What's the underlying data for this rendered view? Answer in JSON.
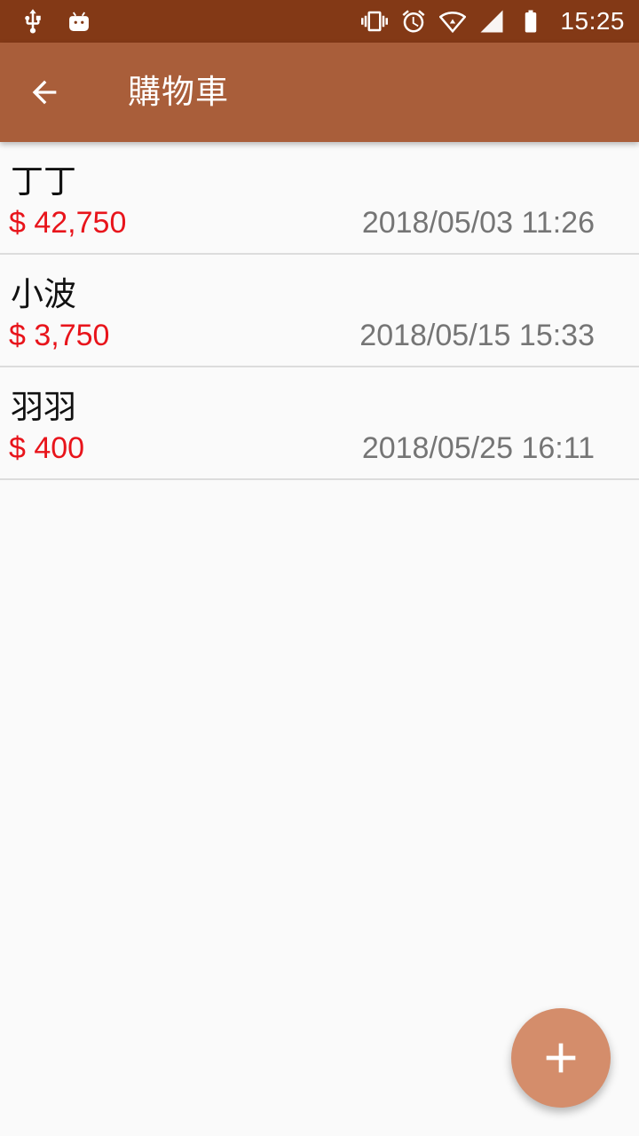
{
  "status_bar": {
    "time": "15:25",
    "left_icons": [
      "usb-icon",
      "android-debug-icon"
    ],
    "right_icons": [
      "vibrate-icon",
      "alarm-icon",
      "wifi-icon",
      "signal-icon",
      "battery-icon"
    ]
  },
  "app_bar": {
    "title": "購物車",
    "back_icon": "arrow-back-icon"
  },
  "colors": {
    "status_bar": "#833916",
    "app_bar": "#a95e3a",
    "price": "#e8141b",
    "date": "#757575",
    "fab": "#d48d6b"
  },
  "carts": [
    {
      "name": "丁丁",
      "price": "$ 42,750",
      "date": "2018/05/03 11:26"
    },
    {
      "name": "小波",
      "price": "$ 3,750",
      "date": "2018/05/15 15:33"
    },
    {
      "name": "羽羽",
      "price": "$ 400",
      "date": "2018/05/25 16:11"
    }
  ],
  "fab": {
    "icon": "add-icon"
  }
}
